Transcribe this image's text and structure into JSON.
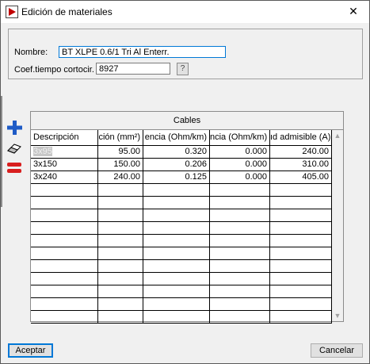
{
  "window": {
    "title": "Edición de materiales",
    "close_glyph": "✕",
    "icon": "app-icon"
  },
  "form": {
    "nombre_label": "Nombre:",
    "nombre_value": "BT XLPE 0.6/1 Tri Al Enterr.",
    "coef_label": "Coef.tiempo cortocir.",
    "coef_value": "8927",
    "help_label": "?"
  },
  "toolbar": {
    "add_icon": "plus-icon",
    "edit_icon": "eraser-icon",
    "delete_icon": "equals-icon"
  },
  "grid": {
    "caption": "Cables",
    "columns": [
      "Descripción",
      "ción (mm²)",
      "encia (Ohm/km)",
      "ncia (Ohm/km)",
      "ıd admisible (A)"
    ],
    "rows": [
      [
        "3x95",
        "95.00",
        "0.320",
        "0.000",
        "240.00"
      ],
      [
        "3x150",
        "150.00",
        "0.206",
        "0.000",
        "310.00"
      ],
      [
        "3x240",
        "240.00",
        "0.125",
        "0.000",
        "405.00"
      ]
    ]
  },
  "buttons": {
    "ok": "Aceptar",
    "cancel": "Cancelar"
  },
  "colors": {
    "accent": "#0078d7",
    "add": "#1e5bc6",
    "delete": "#d81e1e",
    "app_icon": "#c00000"
  }
}
